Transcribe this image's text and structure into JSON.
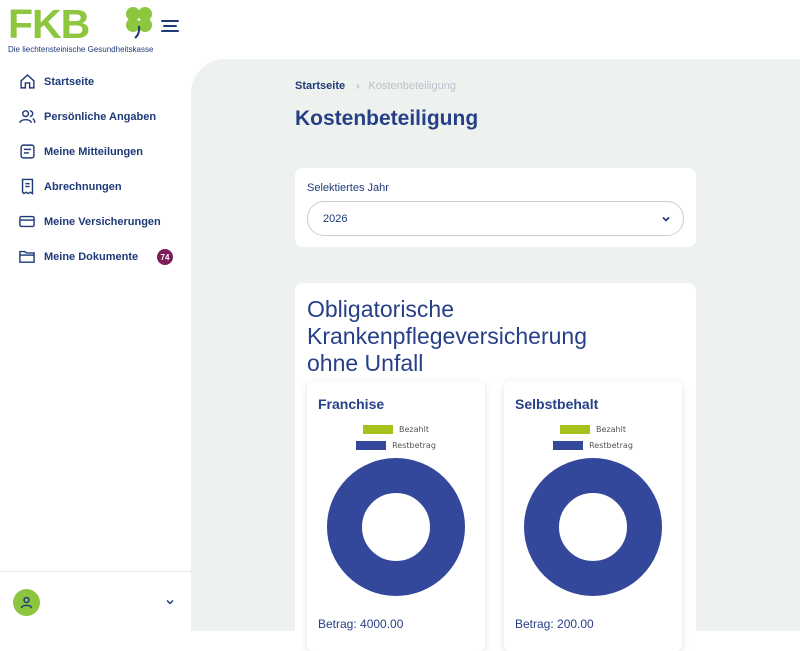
{
  "brand": {
    "logo_text": "FKB",
    "tagline": "Die liechtensteinische Gesundheitskasse",
    "logo_green": "#8dc63f",
    "navy": "#263f87"
  },
  "sidebar": {
    "items": [
      {
        "label": "Startseite",
        "icon": "home-icon"
      },
      {
        "label": "Persönliche Angaben",
        "icon": "users-icon"
      },
      {
        "label": "Meine Mitteilungen",
        "icon": "message-icon"
      },
      {
        "label": "Abrechnungen",
        "icon": "receipt-icon"
      },
      {
        "label": "Meine Versicherungen",
        "icon": "card-icon"
      },
      {
        "label": "Meine Dokumente",
        "icon": "folder-icon",
        "badge": "74"
      }
    ]
  },
  "breadcrumb": {
    "home": "Startseite",
    "separator": "›",
    "current": "Kostenbeteiligung"
  },
  "page": {
    "title": "Kostenbeteiligung"
  },
  "year_selector": {
    "label": "Selektiertes Jahr",
    "value": "2026"
  },
  "insurance": {
    "title": "Obligatorische Krankenpflegeversicherung ohne Unfall",
    "legend": {
      "paid": "Bezahlt",
      "remaining": "Restbetrag",
      "paid_color": "#a4c11d",
      "remaining_color": "#34489b"
    },
    "franchise": {
      "title": "Franchise",
      "amount": "Betrag: 4000.00",
      "paid": 0,
      "remaining": 4000
    },
    "selbstbehalt": {
      "title": "Selbstbehalt",
      "amount": "Betrag: 200.00",
      "paid": 0,
      "remaining": 200
    }
  }
}
